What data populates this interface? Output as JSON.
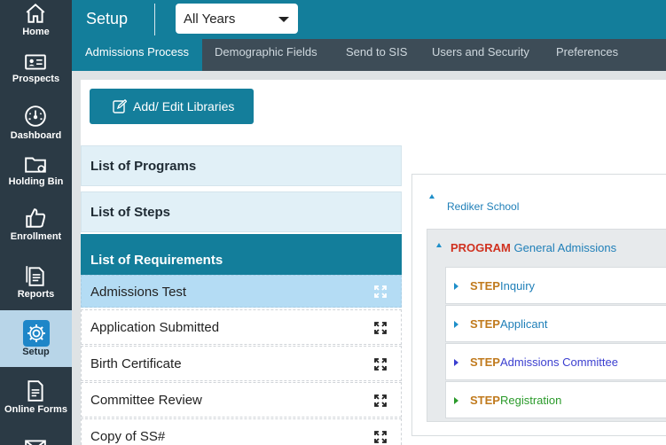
{
  "nav": {
    "items": [
      {
        "label": "Home"
      },
      {
        "label": "Prospects"
      },
      {
        "label": "Dashboard"
      },
      {
        "label": "Holding Bin"
      },
      {
        "label": "Enrollment"
      },
      {
        "label": "Reports"
      },
      {
        "label": "Setup"
      },
      {
        "label": "Online Forms"
      }
    ]
  },
  "header": {
    "title": "Setup",
    "year_select": "All Years"
  },
  "tabs": [
    "Admissions Process",
    "Demographic Fields",
    "Send to SIS",
    "Users and Security",
    "Preferences"
  ],
  "actions": {
    "add_edit_libraries": "Add/ Edit Libraries"
  },
  "sections": {
    "programs": "List of Programs",
    "steps": "List of Steps",
    "requirements": "List of Requirements"
  },
  "requirements": [
    "Admissions Test",
    "Application Submitted",
    "Birth Certificate",
    "Committee Review",
    "Copy of SS#"
  ],
  "tree": {
    "school": "Rediker School",
    "program_keyword": "PROGRAM",
    "program_name": "General Admissions",
    "step_keyword": "STEP",
    "steps": [
      {
        "name": "Inquiry",
        "color": "#1f7fb8"
      },
      {
        "name": "Applicant",
        "color": "#1f7fb8"
      },
      {
        "name": "Admissions Committee",
        "color": "#3b3fd0"
      },
      {
        "name": "Registration",
        "color": "#2a9a2a"
      }
    ]
  },
  "colors": {
    "header": "#137e9b",
    "nav": "#2b3a45",
    "tabbar": "#3d4c57",
    "program_keyword": "#d0311f",
    "step_keyword": "#c07a1d"
  }
}
